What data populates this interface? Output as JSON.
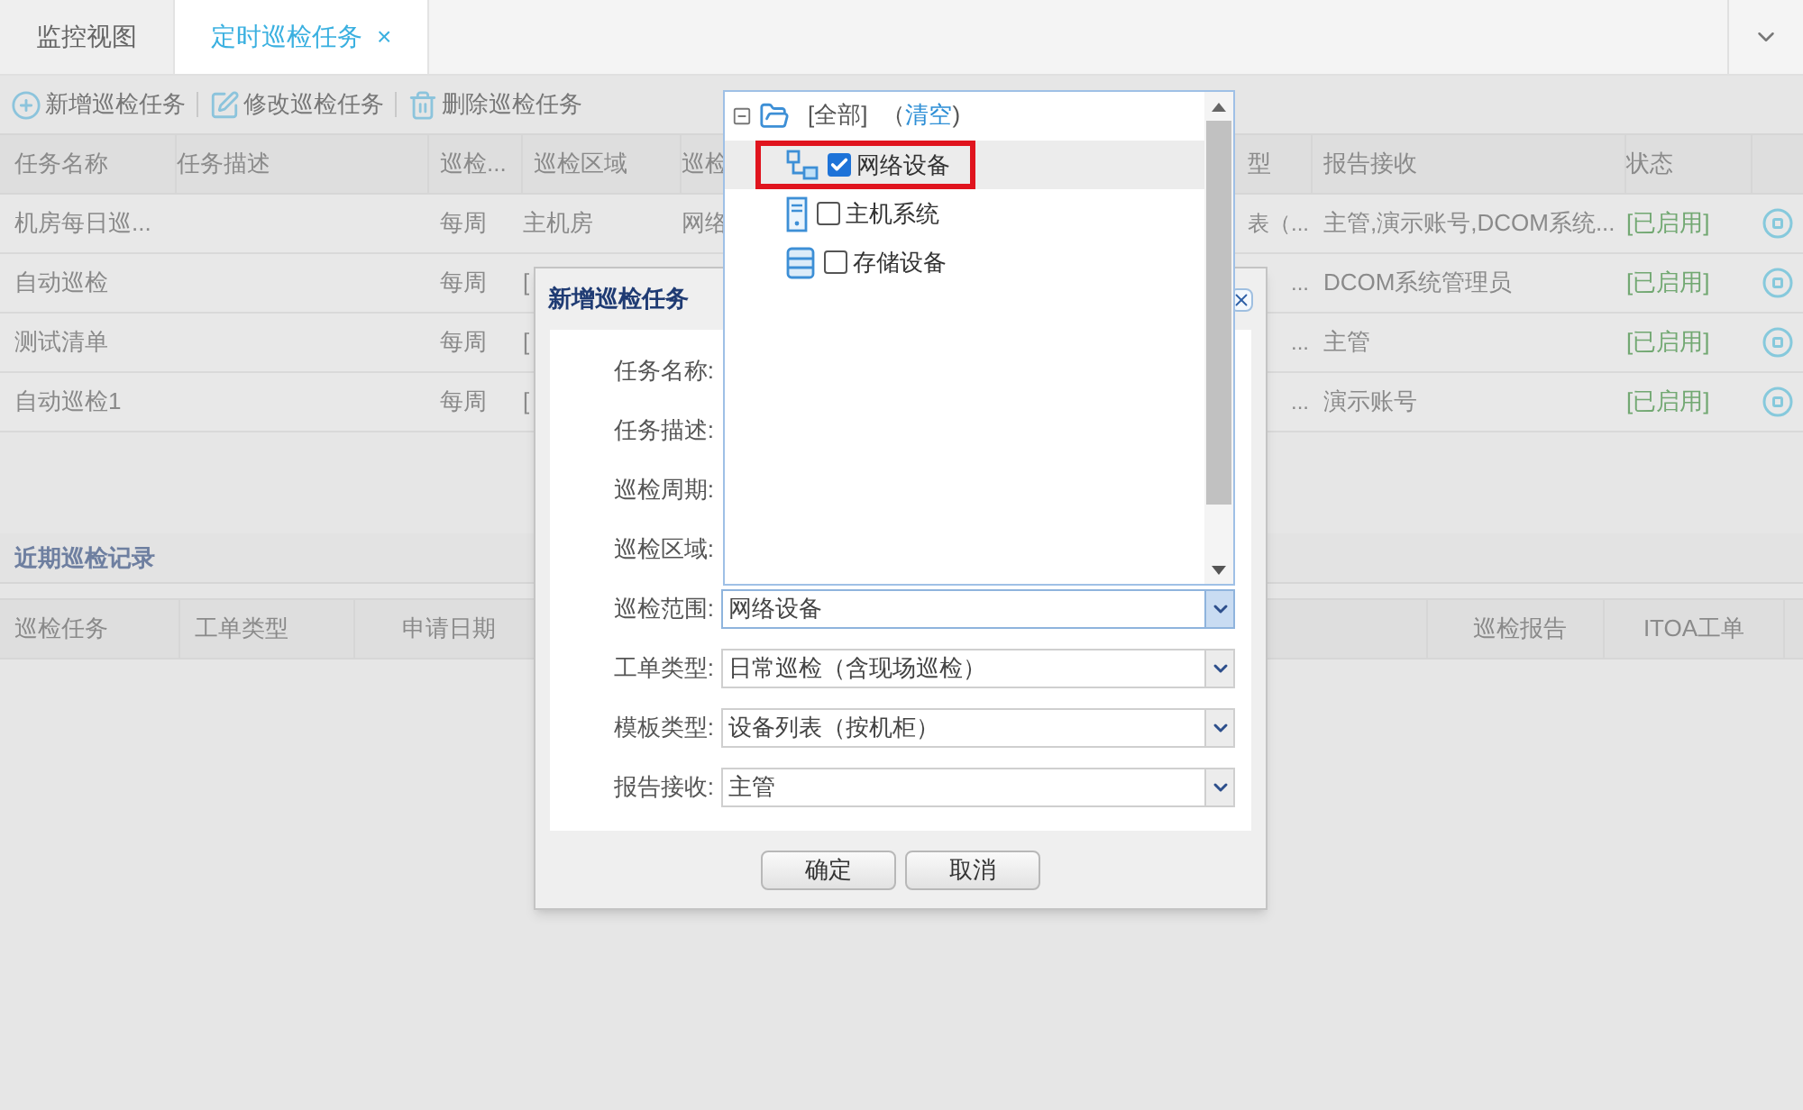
{
  "tabs": [
    {
      "label": "监控视图",
      "selected": false
    },
    {
      "label": "定时巡检任务",
      "selected": true,
      "close": "×"
    }
  ],
  "toolbar": [
    {
      "label": "新增巡检任务",
      "kind": "add"
    },
    {
      "label": "修改巡检任务",
      "kind": "edit"
    },
    {
      "label": "删除巡检任务",
      "kind": "delete"
    }
  ],
  "task_table": {
    "columns": [
      "任务名称",
      "任务描述",
      "巡检...",
      "巡检区域",
      "巡检",
      "型",
      "报告接收",
      "状态"
    ],
    "rows": [
      {
        "name": "机房每日巡...",
        "cycle": "每周",
        "area": "主机房",
        "scope": "网络",
        "column_7": "表（...",
        "receiver": "主管,演示账号,DCOM系统...",
        "status": "[已启用]",
        "enabled": true
      },
      {
        "name": "自动巡检",
        "cycle": "每周",
        "area": "[",
        "column_7": "...",
        "receiver": "DCOM系统管理员",
        "status": "[已启用]",
        "enabled": true
      },
      {
        "name": "测试清单",
        "cycle": "每周",
        "area": "[",
        "column_7": "...",
        "receiver": "主管",
        "status": "[已启用]",
        "enabled": true
      },
      {
        "name": "自动巡检1",
        "cycle": "每周",
        "area": "[",
        "column_7": "...",
        "receiver": "演示账号",
        "status": "[已启用]",
        "enabled": true
      }
    ]
  },
  "records": {
    "title": "近期巡检记录",
    "columns": [
      "巡检任务",
      "工单类型",
      "申请日期",
      "巡检报告",
      "ITOA工单"
    ]
  },
  "dialog": {
    "title": "新增巡检任务",
    "fields": [
      {
        "label": "任务名称:"
      },
      {
        "label": "任务描述:"
      },
      {
        "label": "巡检周期:"
      },
      {
        "label": "巡检区域:"
      },
      {
        "label": "巡检范围:",
        "value": "网络设备",
        "focused": true
      },
      {
        "label": "工单类型:",
        "value": "日常巡检（含现场巡检）",
        "focused": false
      },
      {
        "label": "模板类型:",
        "value": "设备列表（按机柜）",
        "focused": false
      },
      {
        "label": "报告接收:",
        "value": "主管",
        "focused": false
      }
    ],
    "buttons": [
      "确定",
      "取消"
    ]
  },
  "tree": {
    "label": "[全部]",
    "expanded": true,
    "paren_open": "（",
    "action": "清空",
    "paren_close": ")",
    "children": [
      {
        "label": "网络设备",
        "kind": "network",
        "checked": true,
        "selected": true,
        "annotated": true
      },
      {
        "label": "主机系统",
        "kind": "server",
        "checked": false,
        "selected": false,
        "annotated": false
      },
      {
        "label": "存储设备",
        "kind": "storage",
        "checked": false,
        "selected": false,
        "annotated": false
      }
    ]
  }
}
